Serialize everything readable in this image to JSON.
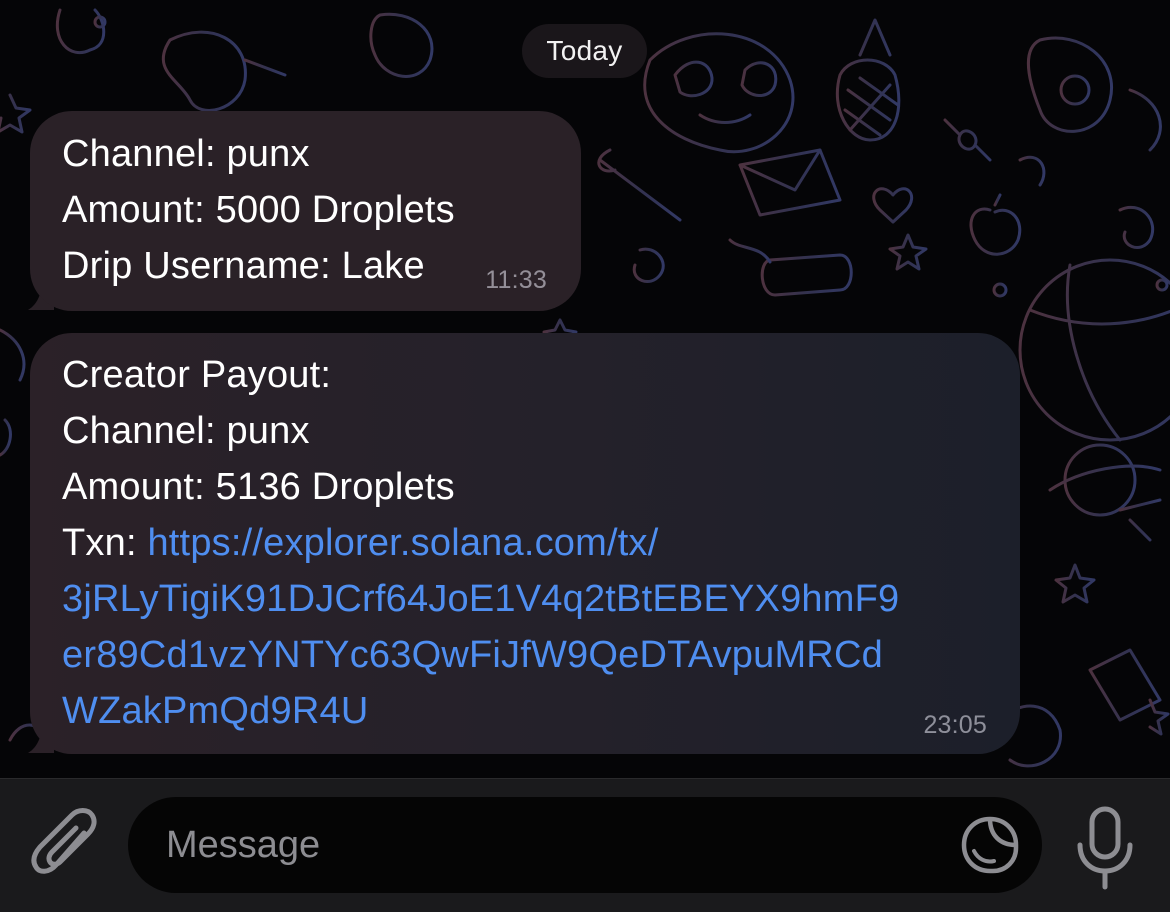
{
  "chat": {
    "date_label": "Today",
    "messages": [
      {
        "lines": [
          "Channel: punx",
          "Amount: 5000 Droplets",
          "Drip Username: Lake"
        ],
        "time": "11:33"
      },
      {
        "lines": [
          "Creator Payout:",
          "Channel: punx",
          "Amount: 5136 Droplets"
        ],
        "txn_label": "Txn: ",
        "link_lines": [
          "https://explorer.solana.com/tx/",
          "3jRLyTigiK91DJCrf64JoE1V4q2tBtEBEYX9hmF9",
          "er89Cd1vzYNTYc63QwFiJfW9QeDTAvpuMRCd",
          "WZakPmQd9R4U"
        ],
        "time": "23:05"
      }
    ]
  },
  "composer": {
    "placeholder": "Message",
    "icons": {
      "attach": "paperclip-icon",
      "sticker": "sticker-icon",
      "mic": "microphone-icon"
    }
  },
  "colors": {
    "incoming_bubble": "#2a2127",
    "link": "#4f8ef0",
    "composer_bg": "#1a1a1c",
    "wallpaper_doodle": "#3a3f6e"
  }
}
